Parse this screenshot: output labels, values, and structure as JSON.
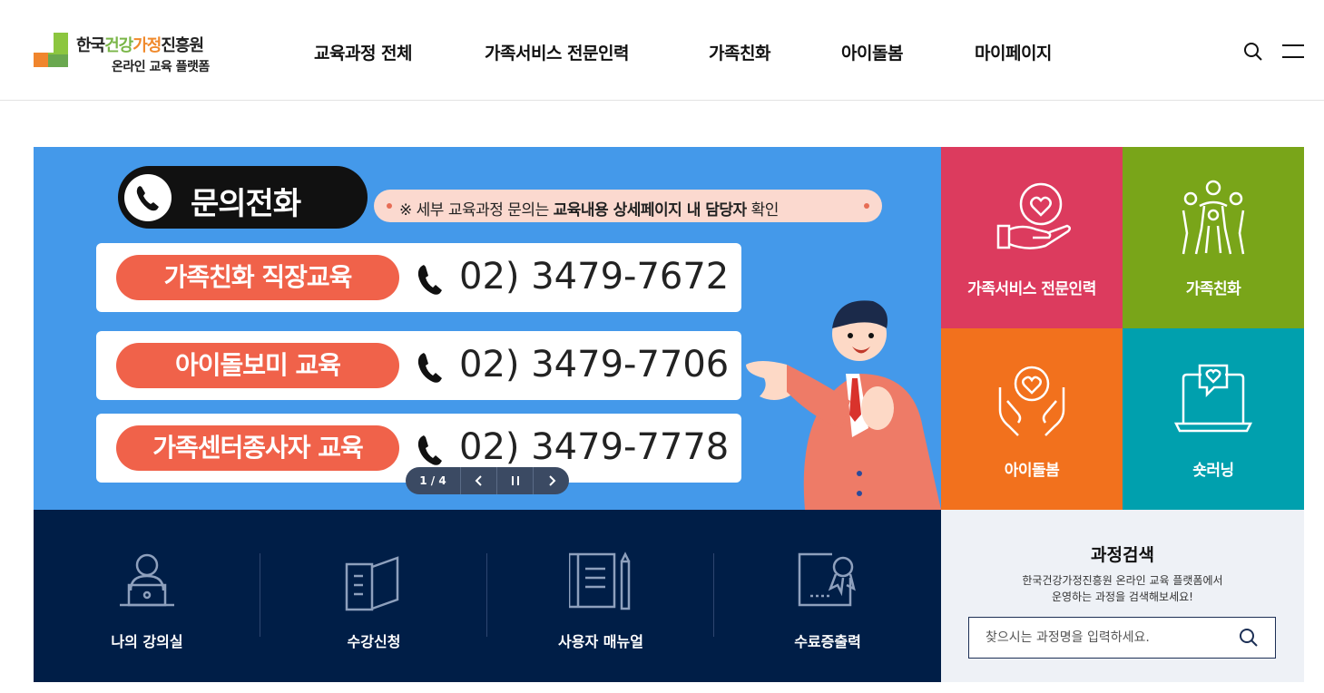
{
  "logo": {
    "line1_part1": "한국",
    "line1_part2": "건강",
    "line1_part3": "가정",
    "line1_part4": "진흥원",
    "line2": "온라인 교육 플랫폼"
  },
  "gnb": [
    {
      "label": "교육과정 전체"
    },
    {
      "label": "가족서비스 전문인력"
    },
    {
      "label": "가족친화"
    },
    {
      "label": "아이돌봄"
    },
    {
      "label": "마이페이지"
    }
  ],
  "banner": {
    "call_label": "문의전화",
    "note_prefix": "※ 세부 교육과정 문의는 ",
    "note_bold": "교육내용 상세페이지 내 담당자",
    "note_suffix": " 확인",
    "contacts": [
      {
        "tag": "가족친화 직장교육",
        "number": "02) 3479-7672"
      },
      {
        "tag": "아이돌보미 교육",
        "number": "02) 3479-7706"
      },
      {
        "tag": "가족센터종사자 교육",
        "number": "02) 3479-7778"
      }
    ],
    "slider_count": "1 / 4"
  },
  "tiles": [
    {
      "label": "가족서비스 전문인력",
      "color": "#dc3b5e"
    },
    {
      "label": "가족친화",
      "color": "#79a519"
    },
    {
      "label": "아이돌봄",
      "color": "#f2711d"
    },
    {
      "label": "숏러닝",
      "color": "#00a0ae"
    }
  ],
  "quick_menu": [
    {
      "label": "나의 강의실",
      "icon": "learner-icon"
    },
    {
      "label": "수강신청",
      "icon": "book-icon"
    },
    {
      "label": "사용자 매뉴얼",
      "icon": "notebook-pencil-icon"
    },
    {
      "label": "수료증출력",
      "icon": "certificate-icon"
    }
  ],
  "course_search": {
    "title": "과정검색",
    "desc_line1": "한국건강가정진흥원 온라인 교육 플랫폼에서",
    "desc_line2": "운영하는 과정을 검색해보세요!",
    "placeholder": "찾으시는 과정명을 입력하세요."
  }
}
